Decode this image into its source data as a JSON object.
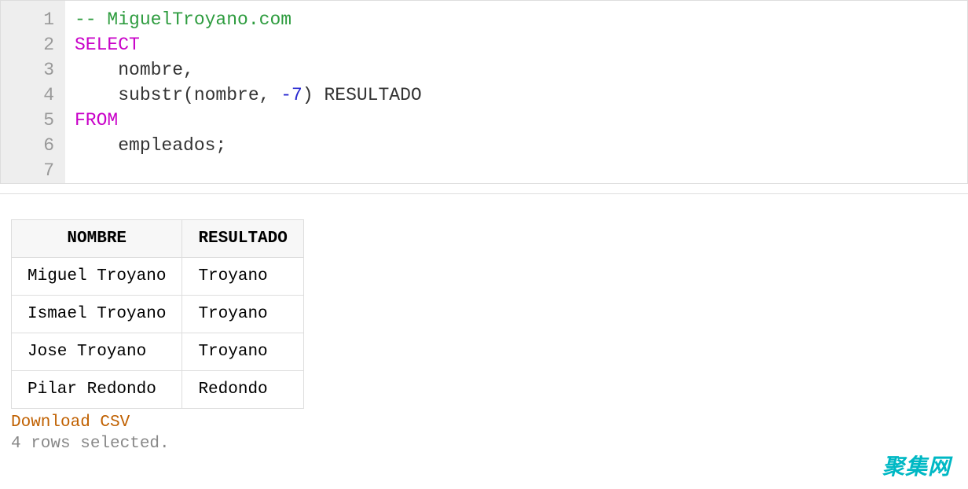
{
  "editor": {
    "line_numbers": [
      "1",
      "2",
      "3",
      "4",
      "5",
      "6",
      "7"
    ],
    "code": {
      "l1_comment": "-- MiguelTroyano.com",
      "l2_kw": "SELECT",
      "l3_txt": "    nombre,",
      "l4_txt_a": "    substr(nombre, ",
      "l4_num": "-7",
      "l4_txt_b": ") RESULTADO",
      "l5_kw": "FROM",
      "l6_txt": "    empleados;"
    }
  },
  "table": {
    "headers": [
      "NOMBRE",
      "RESULTADO"
    ],
    "rows": [
      [
        "Miguel Troyano",
        "Troyano"
      ],
      [
        "Ismael Troyano",
        "Troyano"
      ],
      [
        "Jose Troyano",
        "Troyano"
      ],
      [
        "Pilar Redondo",
        "Redondo"
      ]
    ]
  },
  "download_label": "Download CSV",
  "status_text": "4 rows selected.",
  "watermark": "聚集网"
}
